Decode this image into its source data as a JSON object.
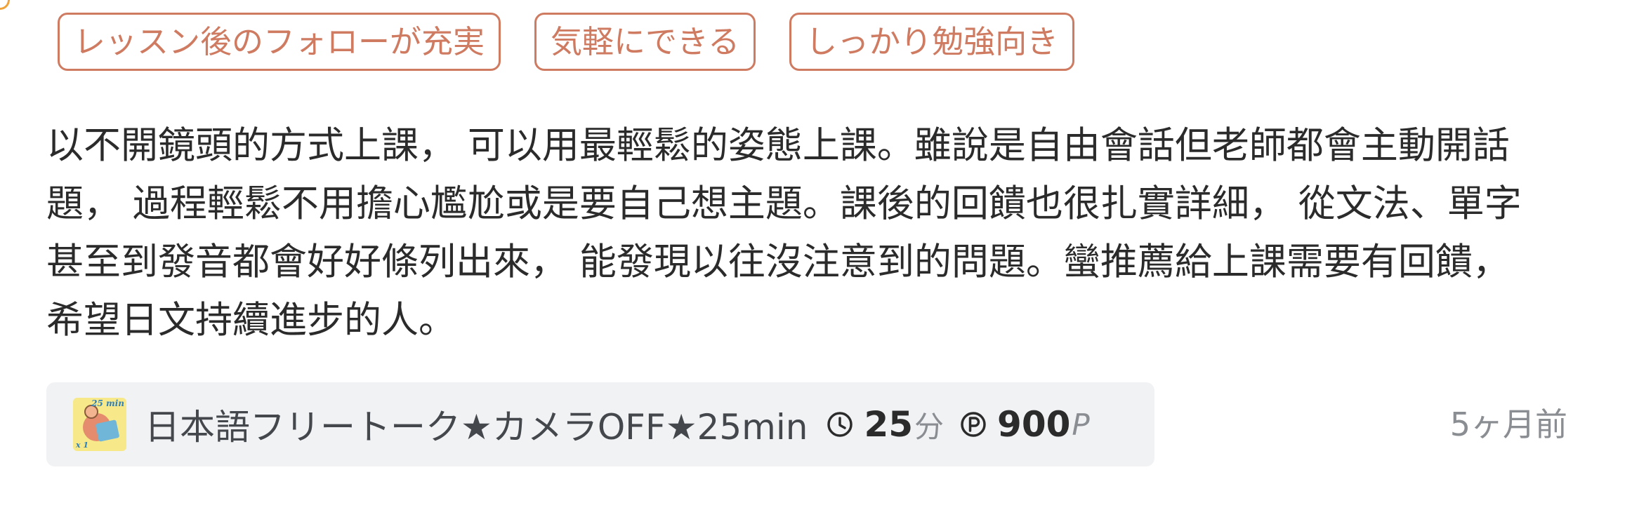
{
  "tags": [
    {
      "label": "レッスン後のフォローが充実"
    },
    {
      "label": "気軽にできる"
    },
    {
      "label": "しっかり勉強向き"
    }
  ],
  "review": {
    "lines": [
      "以不開鏡頭的方式上課， 可以用最輕鬆的姿態上課。雖說是自由會話但老師都會主動開話",
      "題， 過程輕鬆不用擔心尷尬或是要自己想主題。課後的回饋也很扎實詳細， 從文法、單字",
      "甚至到發音都會好好條列出來， 能發現以往沒注意到的問題。蠻推薦給上課需要有回饋，",
      "希望日文持續進步的人。"
    ]
  },
  "lesson": {
    "thumbnail": {
      "min_label": "25 min",
      "count_label": "x 1"
    },
    "title": "日本語フリートーク★カメラOFF★25min",
    "duration_value": "25",
    "duration_unit": "分",
    "price_value": "900",
    "price_unit": "P",
    "icons": {
      "duration": "clock-icon",
      "price": "points-icon"
    }
  },
  "time_ago": "5ヶ月前",
  "colors": {
    "tag_accent": "#cf7b62",
    "card_background": "#f1f2f4",
    "muted_text": "#8a8d92"
  }
}
